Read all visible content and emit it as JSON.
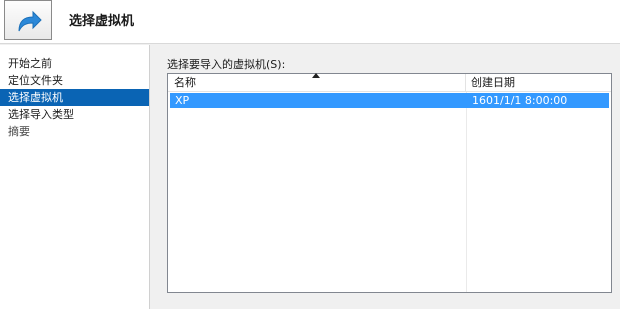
{
  "header": {
    "title": "选择虚拟机",
    "icon": "import-arrow-icon"
  },
  "sidebar": {
    "items": [
      {
        "label": "开始之前",
        "state": "normal"
      },
      {
        "label": "定位文件夹",
        "state": "normal"
      },
      {
        "label": "选择虚拟机",
        "state": "selected"
      },
      {
        "label": "选择导入类型",
        "state": "normal"
      },
      {
        "label": "摘要",
        "state": "disabled"
      }
    ]
  },
  "main": {
    "list_label": "选择要导入的虚拟机(S):",
    "columns": {
      "name": "名称",
      "date": "创建日期"
    },
    "rows": [
      {
        "name": "XP",
        "date": "1601/1/1 8:00:00",
        "selected": true
      }
    ]
  },
  "colors": {
    "selection": "#0a64b4",
    "row_highlight": "#3399ff",
    "accent_icon": "#2b88d8"
  }
}
